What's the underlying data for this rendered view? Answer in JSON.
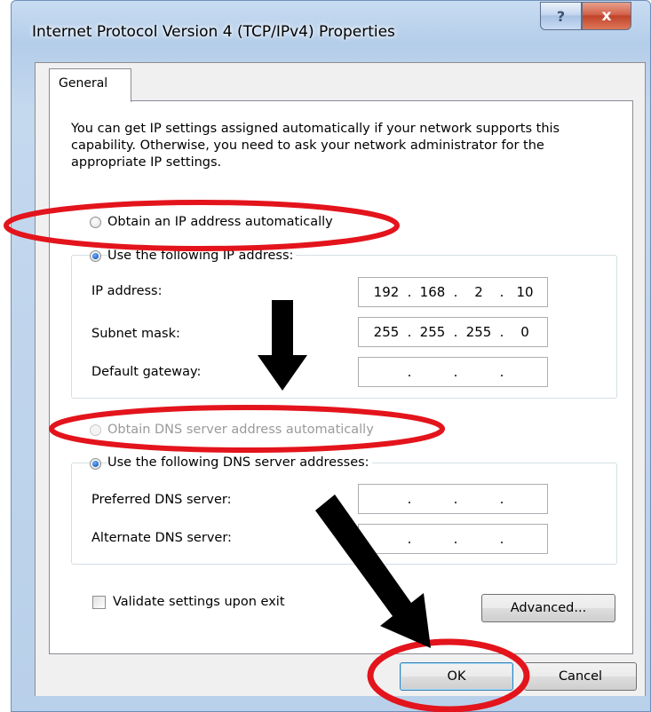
{
  "window": {
    "title": "Internet Protocol Version 4 (TCP/IPv4) Properties",
    "help_label": "?",
    "close_label": "x"
  },
  "tabs": [
    {
      "label": "General",
      "selected": true
    }
  ],
  "description": "You can get IP settings assigned automatically if your network supports this capability. Otherwise, you need to ask your network administrator for the appropriate IP settings.",
  "ip": {
    "auto_label": "Obtain an IP address automatically",
    "manual_label": "Use the following IP address:",
    "selected": "manual",
    "fields": [
      {
        "label": "IP address:",
        "octets": [
          "192",
          "168",
          "2",
          "10"
        ]
      },
      {
        "label": "Subnet mask:",
        "octets": [
          "255",
          "255",
          "255",
          "0"
        ]
      },
      {
        "label": "Default gateway:",
        "octets": [
          "",
          "",
          "",
          ""
        ]
      }
    ]
  },
  "dns": {
    "auto_label": "Obtain DNS server address automatically",
    "manual_label": "Use the following DNS server addresses:",
    "selected": "manual",
    "fields": [
      {
        "label": "Preferred DNS server:",
        "octets": [
          "",
          "",
          "",
          ""
        ]
      },
      {
        "label": "Alternate DNS server:",
        "octets": [
          "",
          "",
          "",
          ""
        ]
      }
    ]
  },
  "validate": {
    "label": "Validate settings upon exit",
    "checked": false
  },
  "buttons": {
    "advanced": "Advanced...",
    "ok": "OK",
    "cancel": "Cancel"
  },
  "annotations": {
    "color": "#e3141c",
    "arrow_color": "#000000"
  }
}
